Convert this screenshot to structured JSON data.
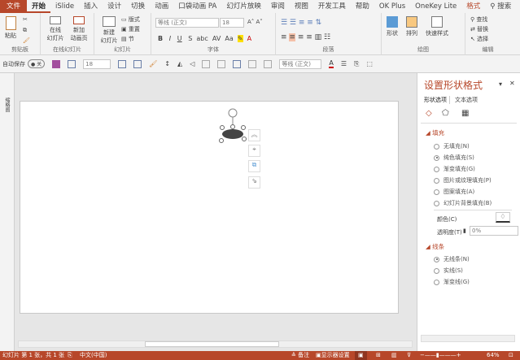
{
  "tabs": [
    "文件",
    "开始",
    "iSlide",
    "插入",
    "设计",
    "切换",
    "动画",
    "口袋动画 PA",
    "幻灯片放映",
    "审阅",
    "视图",
    "开发工具",
    "帮助",
    "OK Plus",
    "OneKey Lite",
    "格式"
  ],
  "search": "搜索",
  "ribbon": {
    "clipboard": {
      "paste": "粘贴",
      "label": "剪贴板"
    },
    "online": {
      "online_slide": "在线\n幻灯片",
      "new_anim": "新加\n动画页",
      "label": "在线幻灯片"
    },
    "slides": {
      "new_slide": "新建\n幻灯片",
      "layout": "版式",
      "reset": "重置",
      "section": "节",
      "label": "幻灯片"
    },
    "font": {
      "font_name": "等线 (正文)",
      "font_size": "18",
      "label": "字体"
    },
    "paragraph": {
      "label": "段落"
    },
    "drawing": {
      "shapes": "形状",
      "arrange": "排列",
      "quick_styles": "快速样式",
      "label": "绘图"
    },
    "editing": {
      "find": "查找",
      "replace": "替换",
      "select": "选择",
      "label": "编辑"
    }
  },
  "qat": {
    "autosave": "自动保存",
    "toggle": "关",
    "font_size": "18",
    "font_name": "等线 (正文)"
  },
  "thumbs_label": "缩略图",
  "pane": {
    "title": "设置形状格式",
    "tab_shape": "形状选项",
    "tab_text": "文本选项",
    "fill_section": "填充",
    "fill_options": [
      {
        "label": "无填充(N)",
        "checked": false
      },
      {
        "label": "纯色填充(S)",
        "checked": true
      },
      {
        "label": "渐变填充(G)",
        "checked": false
      },
      {
        "label": "图片或纹理填充(P)",
        "checked": false
      },
      {
        "label": "图案填充(A)",
        "checked": false
      },
      {
        "label": "幻灯片背景填充(B)",
        "checked": false
      }
    ],
    "color_label": "颜色(C)",
    "transparency_label": "透明度(T)",
    "transparency_value": "0%",
    "line_section": "线条",
    "line_options": [
      {
        "label": "无线条(N)",
        "checked": true
      },
      {
        "label": "实线(S)",
        "checked": false
      },
      {
        "label": "渐变线(G)",
        "checked": false
      }
    ]
  },
  "status": {
    "slide_info": "幻灯片 第 1 张，共 1 张",
    "language": "中文(中国)",
    "notes": "备注",
    "display": "显示器设置",
    "zoom": "64%"
  },
  "colors": {
    "accent": "#b7472a"
  }
}
